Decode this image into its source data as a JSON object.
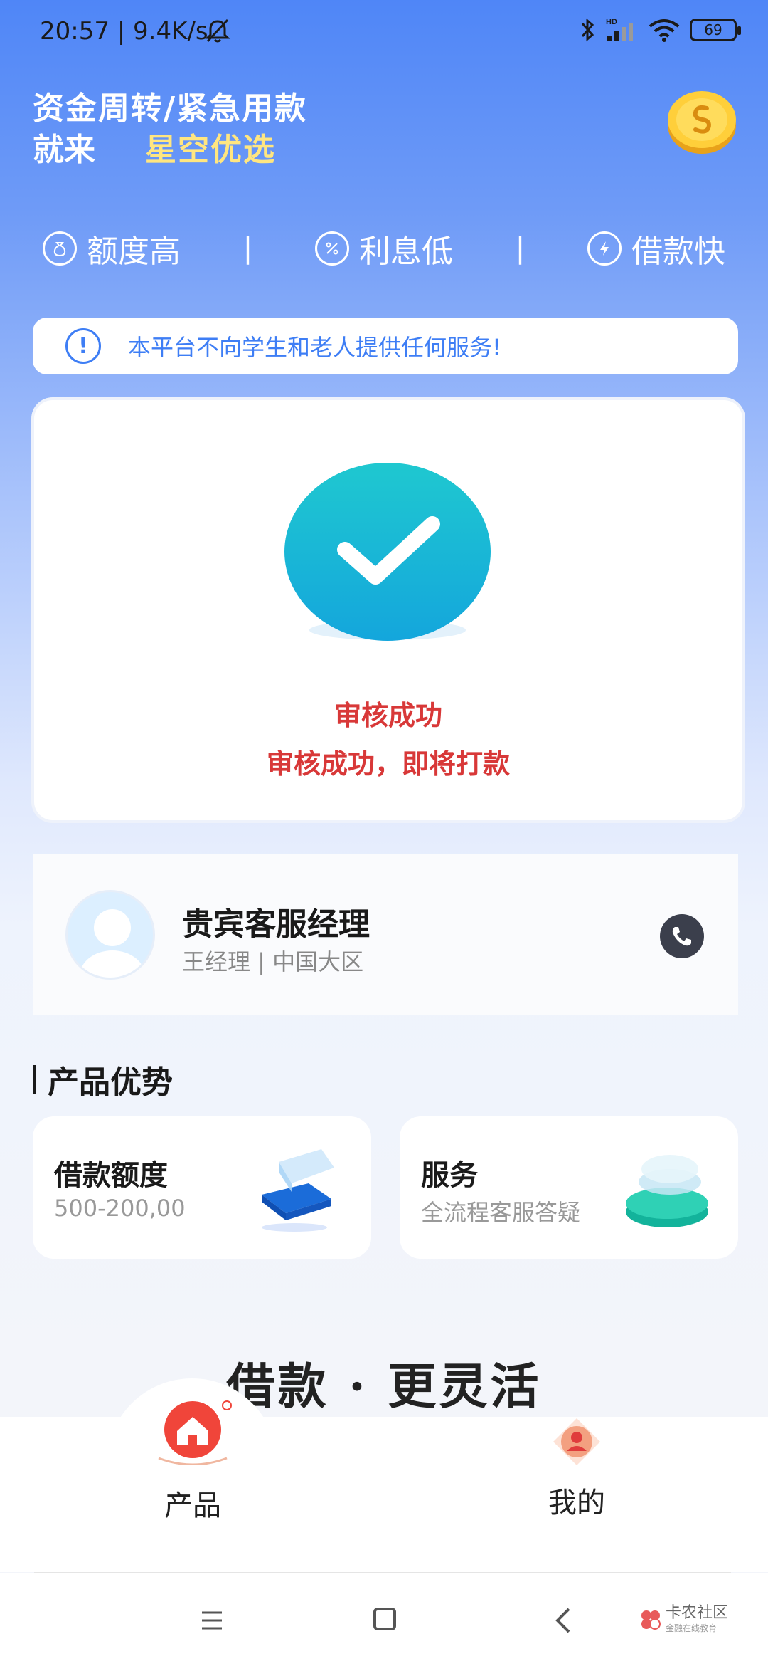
{
  "status_bar": {
    "time": "20:57 | 9.4K/s",
    "battery": "69",
    "icons": [
      "bell-off-icon",
      "bluetooth-icon",
      "signal-icon",
      "wifi-icon",
      "battery-icon"
    ]
  },
  "header": {
    "line1": "资金周转/紧急用款",
    "line2_prefix": "就来",
    "brand": "星空优选"
  },
  "features": [
    {
      "label": "额度高",
      "icon": "money-bag-icon"
    },
    {
      "label": "利息低",
      "icon": "percent-icon"
    },
    {
      "label": "借款快",
      "icon": "lightning-icon"
    }
  ],
  "separator": "|",
  "notice": {
    "text": "本平台不向学生和老人提供任何服务!"
  },
  "review": {
    "title": "审核成功",
    "message": "审核成功，即将打款"
  },
  "manager": {
    "title": "贵宾客服经理",
    "subtitle": "王经理 | 中国大区"
  },
  "advantages": {
    "section_title": "产品优势",
    "items": [
      {
        "title": "借款额度",
        "subtitle": "500-200,00"
      },
      {
        "title": "服务",
        "subtitle": "全流程客服答疑"
      }
    ]
  },
  "slogan": "借款 · 更灵活",
  "tabs": [
    {
      "label": "产品",
      "icon": "home-icon",
      "active": true
    },
    {
      "label": "我的",
      "icon": "user-icon",
      "active": false
    }
  ],
  "watermark": {
    "title": "卡农社区",
    "subtitle": "金融在线教育"
  },
  "colors": {
    "primary": "#3e7ef5",
    "success": "#1bb8d6",
    "alert": "#d83838",
    "brand_yellow": "#ffe680"
  }
}
